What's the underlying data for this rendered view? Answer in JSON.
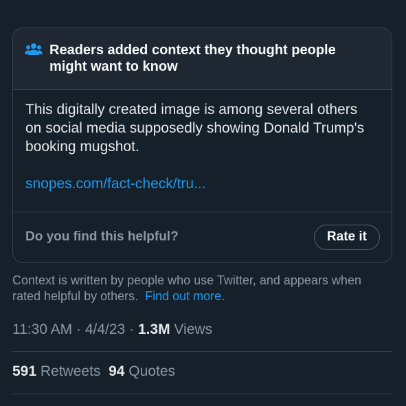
{
  "note": {
    "icon": "people-icon",
    "title": "Readers added context they thought people might want to know",
    "text": "This digitally created image is among several others on social media supposedly showing Donald Trump's booking mugshot.",
    "link": "snopes.com/fact-check/tru...",
    "helpful_question": "Do you find this helpful?",
    "rate_label": "Rate it"
  },
  "context": {
    "text": "Context is written by people who use Twitter, and appears when rated helpful by others.",
    "link": "Find out more",
    "period": "."
  },
  "meta": {
    "time": "11:30 AM",
    "sep1": " · ",
    "date": "4/4/23",
    "sep2": " · ",
    "views_count": "1.3M",
    "views_label": " Views"
  },
  "stats": {
    "retweets_count": "591",
    "retweets_label": " Retweets",
    "quotes_count": "94",
    "quotes_label": " Quotes"
  },
  "colors": {
    "background": "#15202b",
    "accent": "#1d9bf0",
    "border": "#38444d"
  }
}
